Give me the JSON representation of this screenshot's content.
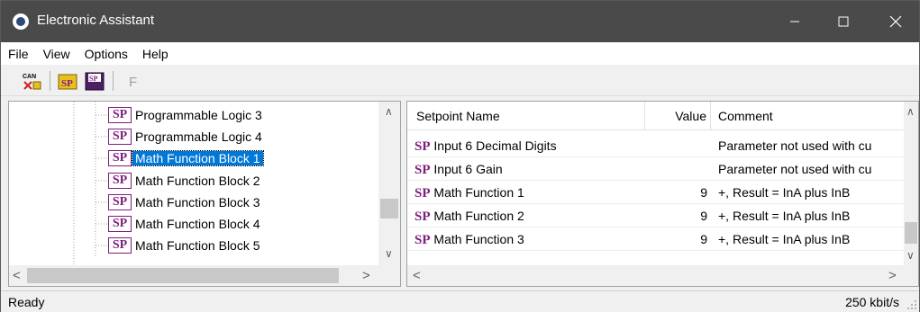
{
  "window": {
    "title": "Electronic Assistant"
  },
  "menu": [
    "File",
    "View",
    "Options",
    "Help"
  ],
  "toolbar": {
    "buttons": [
      {
        "name": "can-connect",
        "label": "CAN"
      },
      {
        "name": "sp-open",
        "label": "SP"
      },
      {
        "name": "sp-save",
        "label": "SP"
      },
      {
        "name": "f-disabled",
        "label": "F"
      }
    ]
  },
  "tree": {
    "items": [
      {
        "icon": "SP",
        "label": "Programmable Logic 3"
      },
      {
        "icon": "SP",
        "label": "Programmable Logic 4"
      },
      {
        "icon": "SP",
        "label": "Math Function Block 1",
        "selected": true
      },
      {
        "icon": "SP",
        "label": "Math Function Block 2"
      },
      {
        "icon": "SP",
        "label": "Math Function Block 3"
      },
      {
        "icon": "SP",
        "label": "Math Function Block 4"
      },
      {
        "icon": "SP",
        "label": "Math Function Block 5"
      }
    ]
  },
  "grid": {
    "columns": [
      "Setpoint Name",
      "Value",
      "Comment"
    ],
    "rows": [
      {
        "icon": "SP",
        "name": "Input 6 Decimal Digits",
        "value": "",
        "comment": "Parameter not used with cu"
      },
      {
        "icon": "SP",
        "name": "Input 6 Gain",
        "value": "",
        "comment": "Parameter not used with cu"
      },
      {
        "icon": "SP",
        "name": "Math Function 1",
        "value": "9",
        "comment": "+,  Result = InA plus InB"
      },
      {
        "icon": "SP",
        "name": "Math Function 2",
        "value": "9",
        "comment": "+,  Result = InA plus InB"
      },
      {
        "icon": "SP",
        "name": "Math Function 3",
        "value": "9",
        "comment": "+,  Result = InA plus InB"
      }
    ]
  },
  "status": {
    "left": "Ready",
    "right": "250 kbit/s"
  },
  "colors": {
    "titlebar": "#4a4a4a",
    "selection": "#0078d7",
    "sp_icon": "#7b1f7b"
  }
}
